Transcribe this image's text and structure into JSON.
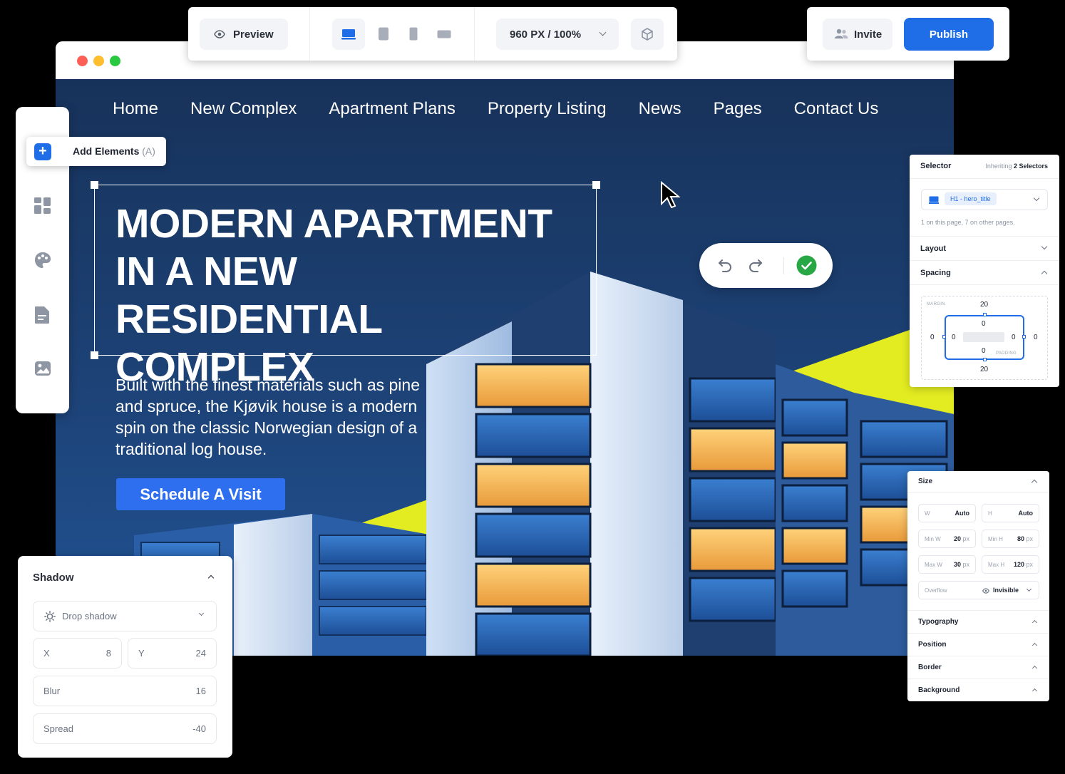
{
  "window": {
    "title": ""
  },
  "toolbar": {
    "preview_label": "Preview",
    "zoom_label": "960 PX / 100%"
  },
  "actions": {
    "invite_label": "Invite",
    "publish_label": "Publish"
  },
  "rail": {
    "add_elements_label": "Add Elements",
    "add_elements_shortcut": "(A)"
  },
  "site": {
    "nav": [
      "Home",
      "New Complex",
      "Apartment Plans",
      "Property Listing",
      "News",
      "Pages",
      "Contact Us"
    ],
    "hero_line1": "MODERN APARTMENT",
    "hero_line2": "IN A NEW RESIDENTIAL",
    "hero_line3": "COMPLEX",
    "hero_description": "Built with the finest materials such as pine and spruce, the Kjøvik house is a modern spin on the classic Norwegian design of a traditional log house.",
    "cta_label": "Schedule A Visit"
  },
  "selector_panel": {
    "title": "Selector",
    "inheriting_prefix": "Inheriting",
    "inheriting_count": "2 Selectors",
    "selected": "H1 - hero_title",
    "usage_note": "1 on this page, 7 on other pages.",
    "layout_label": "Layout",
    "spacing_label": "Spacing",
    "margin_label": "MARGIN",
    "padding_label": "PADDING",
    "margin_top": "20",
    "margin_bottom": "20",
    "margin_left": "0",
    "margin_right": "0",
    "padding_top": "0",
    "padding_bottom": "0",
    "padding_left": "0",
    "padding_right": "0"
  },
  "size_panel": {
    "title": "Size",
    "w_label": "W",
    "w_value": "Auto",
    "h_label": "H",
    "h_value": "Auto",
    "minw_label": "Min W",
    "minw_value": "20",
    "minw_unit": "px",
    "minh_label": "Min H",
    "minh_value": "80",
    "minh_unit": "px",
    "maxw_label": "Max W",
    "maxw_value": "30",
    "maxw_unit": "px",
    "maxh_label": "Max H",
    "maxh_value": "120",
    "maxh_unit": "px",
    "overflow_label": "Overflow",
    "overflow_value": "Invisible",
    "sections": [
      "Typography",
      "Position",
      "Border",
      "Background"
    ]
  },
  "shadow_panel": {
    "title": "Shadow",
    "type": "Drop shadow",
    "x_label": "X",
    "x_value": "8",
    "y_label": "Y",
    "y_value": "24",
    "blur_label": "Blur",
    "blur_value": "16",
    "spread_label": "Spread",
    "spread_value": "-40"
  },
  "colors": {
    "accent": "#1f6ee8",
    "cta": "#2e6ff0",
    "hero_bg": "#1d4378",
    "highlight": "#e3ec21",
    "success": "#28a745"
  },
  "icons": [
    "eye-icon",
    "desktop-icon",
    "tablet-icon",
    "mobile-icon",
    "mobile-landscape-icon",
    "chevron-down-icon",
    "cube-icon",
    "users-icon",
    "plus-icon",
    "grid-icon",
    "palette-icon",
    "document-icon",
    "image-icon",
    "undo-icon",
    "redo-icon",
    "check-icon",
    "cursor-icon",
    "sun-icon"
  ]
}
